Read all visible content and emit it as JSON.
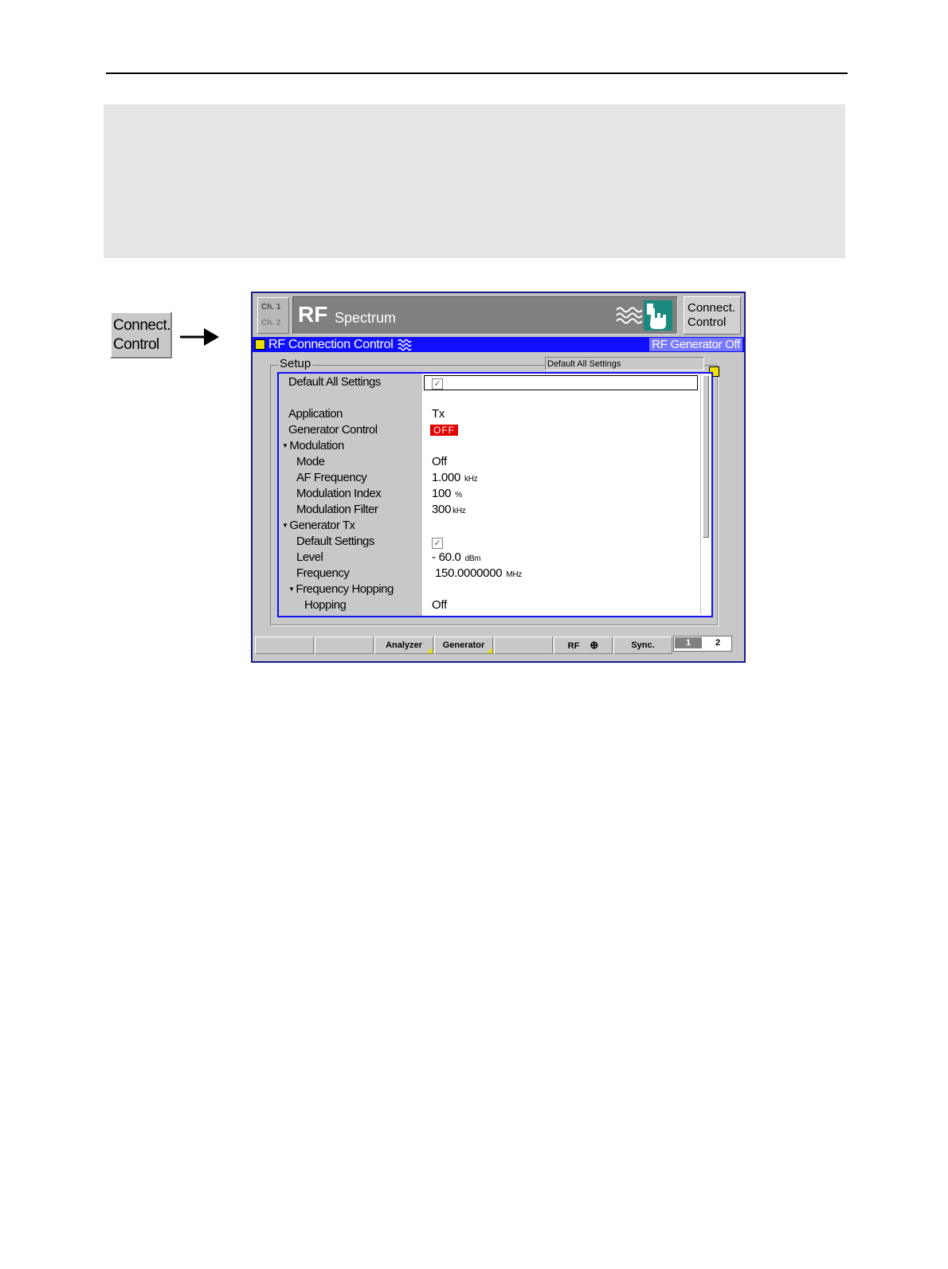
{
  "side_button": {
    "line1": "Connect.",
    "line2": "Control"
  },
  "titlebar": {
    "ch1": "Ch. 1",
    "ch2": "Ch. 2",
    "title": "RF",
    "subtitle": "Spectrum",
    "connect_line1": "Connect.",
    "connect_line2": "Control"
  },
  "menu": {
    "title": "RF Connection Control",
    "status": "RF Generator Off"
  },
  "setup": {
    "label": "Setup",
    "hint": "Default All Settings",
    "rows": [
      {
        "label": "Default All Settings",
        "value": "✓",
        "type": "check"
      },
      {
        "label": "Application",
        "value": "Tx"
      },
      {
        "label": "Generator Control",
        "value": "OFF",
        "type": "badge"
      },
      {
        "label": "Modulation",
        "value": "",
        "expander": true
      },
      {
        "label": "Mode",
        "value": "Off"
      },
      {
        "label": "AF Frequency",
        "value": "1.000",
        "unit": "kHz"
      },
      {
        "label": "Modulation Index",
        "value": "100",
        "unit": "%"
      },
      {
        "label": "Modulation Filter",
        "value": "300",
        "unit": "kHz"
      },
      {
        "label": "Generator Tx",
        "value": "",
        "expander": true
      },
      {
        "label": "Default Settings",
        "value": "✓",
        "type": "check"
      },
      {
        "label": "Level",
        "value": "- 60.0",
        "unit": "dBm"
      },
      {
        "label": "Frequency",
        "value": "150.0000000",
        "unit": "MHz"
      },
      {
        "label": "Frequency Hopping",
        "value": "",
        "expander": true
      },
      {
        "label": "Hopping",
        "value": "Off"
      }
    ]
  },
  "softkeys": {
    "analyzer": "Analyzer",
    "generator": "Generator",
    "rf": "RF",
    "sync": "Sync.",
    "page1": "1",
    "page2": "2"
  },
  "colors": {
    "menubar": "#1010ff",
    "off_badge": "#e00000",
    "hand_icon": "#1a8a80"
  }
}
